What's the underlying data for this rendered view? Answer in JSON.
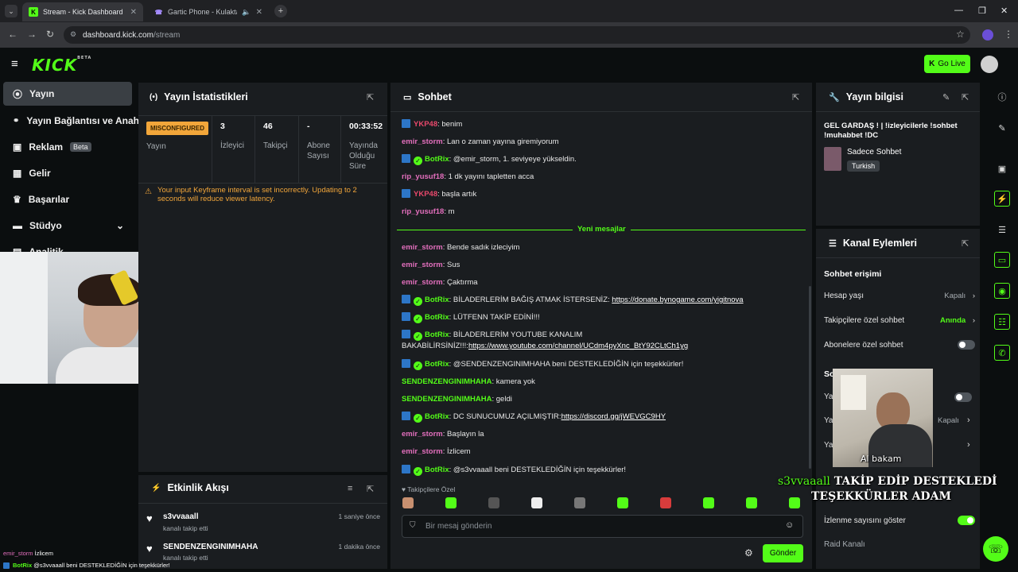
{
  "browser": {
    "tabs": [
      {
        "title": "Stream - Kick Dashboard",
        "favicon": "K"
      },
      {
        "title": "Gartic Phone - Kulaktan Ku",
        "favicon": "☎"
      }
    ],
    "url_host": "dashboard.kick.com",
    "url_path": "/stream"
  },
  "header": {
    "logo": "KICK",
    "logo_sup": "BETA",
    "go_live": "Go Live"
  },
  "sidebar": {
    "items": [
      {
        "label": "Yayın",
        "icon": "broadcast-icon",
        "glyph": "⦿"
      },
      {
        "label": "Yayın Bağlantısı ve Anahtar",
        "icon": "link-icon",
        "glyph": "🔗"
      },
      {
        "label": "Reklam",
        "icon": "ad-icon",
        "glyph": "▣"
      },
      {
        "label": "Gelir",
        "icon": "chart-icon",
        "glyph": "▦"
      },
      {
        "label": "Başarılar",
        "icon": "trophy-icon",
        "glyph": "♛"
      },
      {
        "label": "Stüdyo",
        "icon": "studio-icon",
        "glyph": "▬"
      },
      {
        "label": "Analitik",
        "icon": "analytics-icon",
        "glyph": "▤"
      }
    ],
    "beta": "Beta"
  },
  "stats": {
    "title": "Yayın İstatistikleri",
    "status": "MISCONFIGURED",
    "status_label": "Yayın",
    "cells": [
      {
        "value": "3",
        "label": "İzleyici"
      },
      {
        "value": "46",
        "label": "Takipçi"
      },
      {
        "value": "-",
        "label": "Abone Sayısı"
      },
      {
        "value": "00:33:52",
        "label": "Yayında Olduğu Süre"
      }
    ],
    "warning": "Your input Keyframe interval is set incorrectly. Updating to 2 seconds will reduce viewer latency."
  },
  "events": {
    "title": "Etkinlik Akışı",
    "items": [
      {
        "user": "s3vvaaall",
        "desc": "kanalı takip etti",
        "time": "1 saniye önce"
      },
      {
        "user": "SENDENZENGINIMHAHA",
        "desc": "kanalı takip etti",
        "time": "1 dakika önce"
      }
    ]
  },
  "chat": {
    "title": "Sohbet",
    "new_messages": "Yeni mesajlar",
    "followers_only": "Takipçilere Özel",
    "input_placeholder": "Bir mesaj gönderin",
    "send": "Gönder",
    "messages": [
      {
        "user": "YKP48",
        "color": "#e8486b",
        "bot": true,
        "verified": false,
        "text": "benim"
      },
      {
        "user": "emir_storm",
        "color": "#e36fbd",
        "bot": false,
        "verified": false,
        "text": "Lan o zaman yayına giremiyorum"
      },
      {
        "user": "BotRix",
        "color": "#53fc18",
        "bot": true,
        "verified": true,
        "text": "@emir_storm, 1. seviyeye yükseldin."
      },
      {
        "user": "rip_yusuf18",
        "color": "#e36fbd",
        "bot": false,
        "verified": false,
        "text": "1 dk yayını tapletten acca"
      },
      {
        "user": "YKP48",
        "color": "#e8486b",
        "bot": true,
        "verified": false,
        "text": "başla artık"
      },
      {
        "user": "rip_yusuf18",
        "color": "#e36fbd",
        "bot": false,
        "verified": false,
        "text": "m"
      },
      {
        "user": "emir_storm",
        "color": "#e36fbd",
        "bot": false,
        "verified": false,
        "text": "Bende sadık izleciyim"
      },
      {
        "user": "emir_storm",
        "color": "#e36fbd",
        "bot": false,
        "verified": false,
        "text": "Sus"
      },
      {
        "user": "emir_storm",
        "color": "#e36fbd",
        "bot": false,
        "verified": false,
        "text": "Çaktırma"
      },
      {
        "user": "BotRix",
        "color": "#53fc18",
        "bot": true,
        "verified": true,
        "text": "BİLADERLERİM BAĞIŞ ATMAK İSTERSENİZ: ",
        "link": "https://donate.bynogame.com/yigitnova"
      },
      {
        "user": "BotRix",
        "color": "#53fc18",
        "bot": true,
        "verified": true,
        "text": "LÜTFENN TAKİP EDİNİ!!!"
      },
      {
        "user": "BotRix",
        "color": "#53fc18",
        "bot": true,
        "verified": true,
        "text": "BİLADERLERİM YOUTUBE KANALIM BAKABİLİRSİNİZ!!!:",
        "link": "https://www.youtube.com/channel/UCdm4pyXnc_BtY92CLtCh1yg"
      },
      {
        "user": "BotRix",
        "color": "#53fc18",
        "bot": true,
        "verified": true,
        "text": "@SENDENZENGINIMHAHA beni DESTEKLEDİĞİN için teşekkürler!"
      },
      {
        "user": "SENDENZENGINIMHAHA",
        "color": "#53fc18",
        "bot": false,
        "verified": false,
        "text": "kamera yok"
      },
      {
        "user": "SENDENZENGINIMHAHA",
        "color": "#53fc18",
        "bot": false,
        "verified": false,
        "text": "geldi"
      },
      {
        "user": "BotRix",
        "color": "#53fc18",
        "bot": true,
        "verified": true,
        "text": "DC SUNUCUMUZ AÇILMIŞTIR:",
        "link": "https://discord.gg/jWEVGC9HY"
      },
      {
        "user": "emir_storm",
        "color": "#e36fbd",
        "bot": false,
        "verified": false,
        "text": "Başlayın la"
      },
      {
        "user": "emir_storm",
        "color": "#e36fbd",
        "bot": false,
        "verified": false,
        "text": "İzlicem"
      },
      {
        "user": "BotRix",
        "color": "#53fc18",
        "bot": true,
        "verified": true,
        "text": "@s3vvaaall beni DESTEKLEDİĞİN için teşekkürler!"
      }
    ]
  },
  "stream_info": {
    "title": "Yayın bilgisi",
    "stream_title": "GEL GARDAŞ ! | !izleyicilerle !sohbet !muhabbet !DC",
    "category": "Sadece Sohbet",
    "language": "Turkish"
  },
  "channel_actions": {
    "title": "Kanal Eylemleri",
    "chat_access": "Sohbet erişimi",
    "rows": [
      {
        "label": "Hesap yaşı",
        "value": "Kapalı",
        "type": "chevron"
      },
      {
        "label": "Takipçilere özel sohbet",
        "value": "Anında",
        "type": "chevron",
        "value_color": "#53fc18"
      },
      {
        "label": "Abonelere özel sohbet",
        "value": "",
        "type": "toggle",
        "on": false
      }
    ],
    "section2": "Sohbet",
    "view_count": "İzlenme sayısını göster",
    "raid": "Raid Kanalı"
  },
  "overlay": {
    "cam2_caption": "Al bakam",
    "alert_user": "s3vvaaall",
    "alert_line1": "TAKİP EDİP DESTEKLEDİ",
    "alert_line2": "TEŞEKKÜRLER ADAM",
    "bottom_chat": [
      {
        "user": "emir_storm",
        "text": "İzlicem"
      },
      {
        "user": "BotRix",
        "text": "@s3vvaaall beni DESTEKLEDİĞİN için teşekkürler!"
      }
    ]
  },
  "colors": {
    "accent": "#53fc18",
    "panel": "#1a1d20",
    "background": "#0b0e0f",
    "warning": "#f2a63a"
  }
}
